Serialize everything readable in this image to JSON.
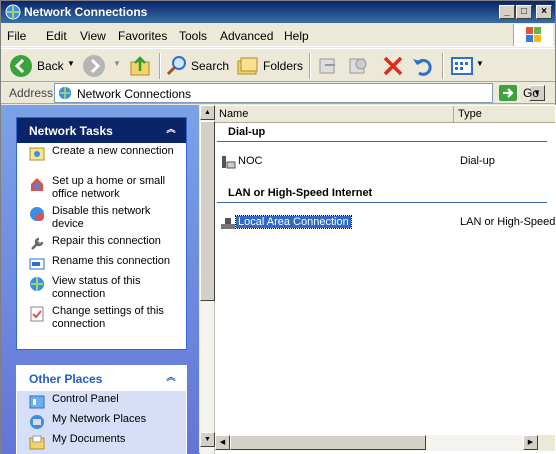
{
  "window": {
    "title": "Network Connections"
  },
  "menu": [
    "File",
    "Edit",
    "View",
    "Favorites",
    "Tools",
    "Advanced",
    "Help"
  ],
  "toolbar": {
    "back_label": "Back",
    "search_label": "Search",
    "folders_label": "Folders"
  },
  "address": {
    "label": "Address",
    "value": "Network Connections",
    "go_label": "Go"
  },
  "network_tasks": {
    "title": "Network Tasks",
    "items": [
      {
        "label": "Create a new connection",
        "icon": "new-connection-icon"
      },
      {
        "label": "Set up a home or small office network",
        "icon": "home-network-icon"
      },
      {
        "label": "Disable this network device",
        "icon": "disable-device-icon"
      },
      {
        "label": "Repair this connection",
        "icon": "repair-icon"
      },
      {
        "label": "Rename this connection",
        "icon": "rename-icon"
      },
      {
        "label": "View status of this connection",
        "icon": "status-icon"
      },
      {
        "label": "Change settings of this connection",
        "icon": "settings-icon"
      }
    ]
  },
  "other_places": {
    "title": "Other Places",
    "items": [
      {
        "label": "Control Panel",
        "icon": "control-panel-icon"
      },
      {
        "label": "My Network Places",
        "icon": "network-places-icon"
      },
      {
        "label": "My Documents",
        "icon": "documents-icon"
      }
    ]
  },
  "columns": {
    "name": "Name",
    "type": "Type"
  },
  "groups": [
    {
      "title": "Dial-up",
      "items": [
        {
          "name": "NOC",
          "type": "Dial-up",
          "selected": false
        }
      ]
    },
    {
      "title": "LAN or High-Speed Internet",
      "items": [
        {
          "name": "Local Area Connection",
          "type": "LAN or High-Speed",
          "selected": true
        }
      ]
    }
  ],
  "colors": {
    "title_bar": "#0a246a",
    "task_pane": "#6375d6",
    "selection": "#316ac5"
  }
}
